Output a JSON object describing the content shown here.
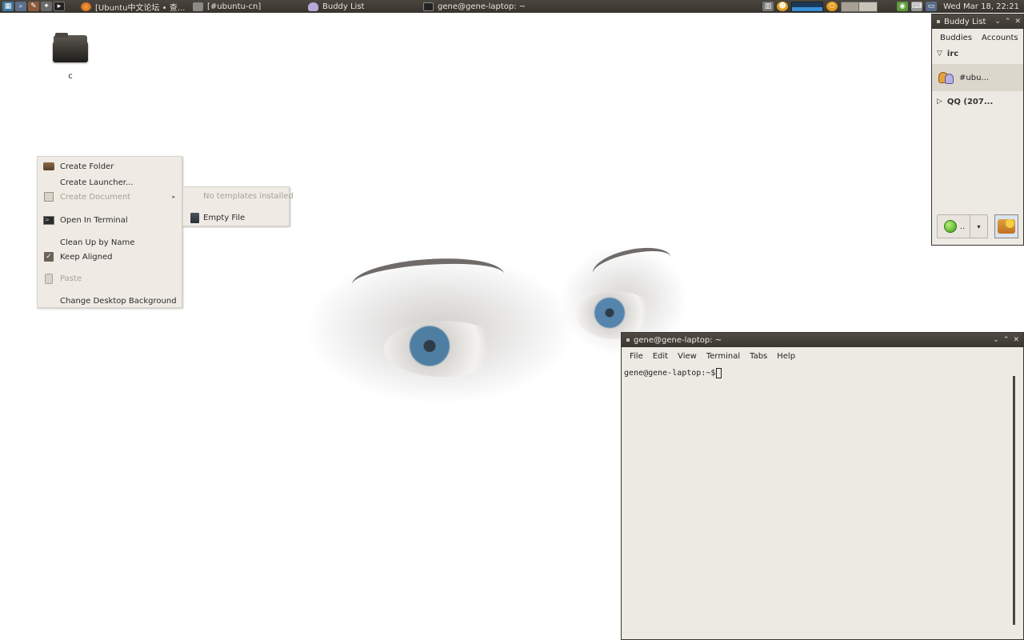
{
  "top_panel": {
    "tasks": [
      {
        "label": "[Ubuntu中文论坛 • 查..."
      },
      {
        "label": "[#ubuntu-cn]"
      },
      {
        "label": "Buddy List"
      },
      {
        "label": "gene@gene-laptop: ~"
      }
    ],
    "clock": "Wed Mar 18, 22:21"
  },
  "desktop": {
    "icons": [
      {
        "label": "c"
      }
    ]
  },
  "context_menu": {
    "items": [
      {
        "label": "Create Folder",
        "enabled": true
      },
      {
        "label": "Create Launcher...",
        "enabled": true
      },
      {
        "label": "Create Document",
        "enabled": false,
        "has_submenu": true
      },
      {
        "label": "Open In Terminal",
        "enabled": true
      },
      {
        "label": "Clean Up by Name",
        "enabled": true
      },
      {
        "label": "Keep Aligned",
        "enabled": true,
        "checked": true
      },
      {
        "label": "Paste",
        "enabled": false
      },
      {
        "label": "Change Desktop Background",
        "enabled": true
      }
    ],
    "submenu": {
      "items": [
        {
          "label": "No templates installed",
          "enabled": false
        },
        {
          "label": "Empty File",
          "enabled": true
        }
      ]
    }
  },
  "buddy_list": {
    "title": "Buddy List",
    "menu": [
      "Buddies",
      "Accounts"
    ],
    "groups": [
      {
        "name": "irc",
        "expanded": true,
        "buddies": [
          "#ubu..."
        ]
      },
      {
        "name": "QQ (207...",
        "expanded": false
      }
    ],
    "status": ".."
  },
  "terminal": {
    "title": "gene@gene-laptop: ~",
    "menu": [
      "File",
      "Edit",
      "View",
      "Terminal",
      "Tabs",
      "Help"
    ],
    "prompt": "gene@gene-laptop:~$"
  }
}
